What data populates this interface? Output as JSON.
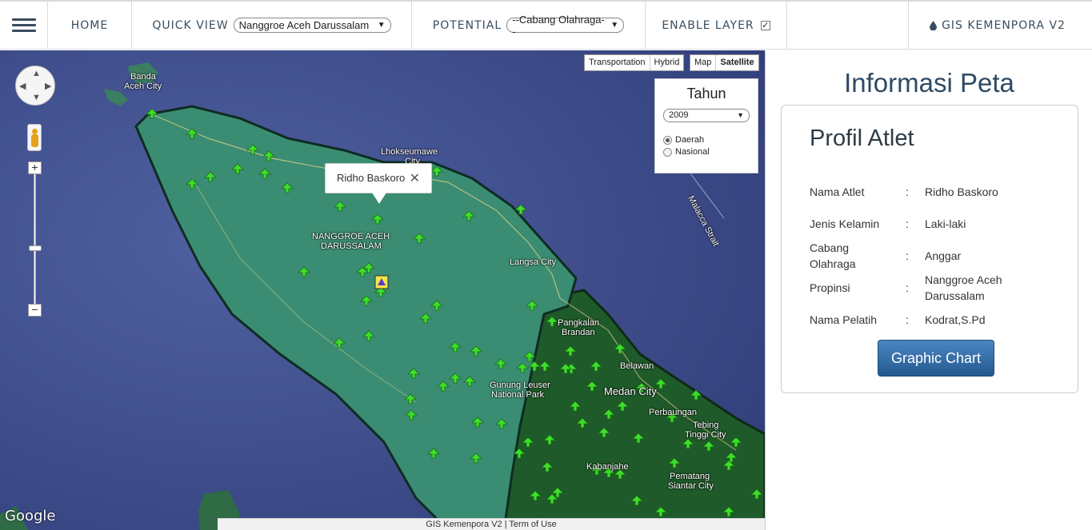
{
  "nav": {
    "home": "HOME",
    "quick_view_label": "QUICK VIEW",
    "quick_view_value": "Nanggroe Aceh Darussalam",
    "potential_label": "POTENTIAL",
    "potential_value": "--Cabang Olahraga--",
    "enable_layer_label": "ENABLE LAYER",
    "enable_layer_checked": "✓",
    "brand": "GIS KEMENPORA V2"
  },
  "map": {
    "types": [
      "Transportation",
      "Hybrid",
      "Map",
      "Satellite"
    ],
    "active_type": "Satellite",
    "tahun_title": "Tahun",
    "tahun_value": "2009",
    "radio_daerah": "Daerah",
    "radio_nasional": "Nasional",
    "selected_radio": "Daerah",
    "infowindow_text": "Ridho Baskoro",
    "labels": {
      "banda": "Banda",
      "aceh_city": "Aceh City",
      "lhokseumawe": "Lhokseumawe",
      "lhok_city": "City",
      "region1": "NANGGROE ACEH",
      "region2": "DARUSSALAM",
      "langsa": "Langsa City",
      "pangkalan": "Pangkalan",
      "brandan": "Brandan",
      "belawan": "Belawan",
      "gunung1": "Gunung Leuser",
      "gunung2": "National Park",
      "medan": "Medan City",
      "perbaungan": "Perbaungan",
      "tebing1": "Tebing",
      "tebing2": "Tinggi City",
      "kabanjahe": "Kabanjahe",
      "pematang1": "Pematang",
      "pematang2": "Siantar City",
      "strait": "Malacca Strait"
    },
    "google": "Google",
    "footer": "GIS Kemenpora V2 | Term of Use"
  },
  "panel": {
    "title": "Informasi Peta",
    "card_title": "Profil Atlet",
    "rows": [
      {
        "key": "Nama Atlet",
        "value": "Ridho Baskoro"
      },
      {
        "key": "Jenis Kelamin",
        "value": "Laki-laki"
      },
      {
        "key": "Cabang Olahraga",
        "value": "Anggar"
      },
      {
        "key": "Propinsi",
        "value": "Nanggroe Aceh Darussalam"
      },
      {
        "key": "Nama Pelatih",
        "value": "Kodrat,S.Pd"
      }
    ],
    "colon": ":",
    "chart_button": "Graphic Chart"
  },
  "colors": {
    "aceh_fill": "#3a8d72",
    "sumut_fill": "#1f5a2a",
    "sea": "#394a8a",
    "marker": "#3ddf2a",
    "accent": "#2e4a63"
  }
}
